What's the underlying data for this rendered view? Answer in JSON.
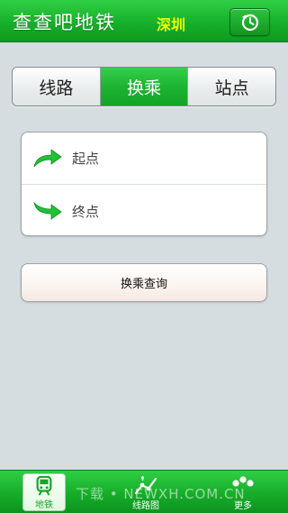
{
  "header": {
    "title": "查查吧地铁",
    "city": "深圳",
    "history_icon": "clock-refresh-icon"
  },
  "tabs": [
    {
      "label": "线路",
      "active": false
    },
    {
      "label": "换乘",
      "active": true
    },
    {
      "label": "站点",
      "active": false
    }
  ],
  "route": {
    "start_placeholder": "起点",
    "end_placeholder": "终点",
    "start_icon": "arrow-up-right-icon",
    "end_icon": "arrow-down-right-icon"
  },
  "search_button_label": "换乘查询",
  "tabbar": {
    "items": [
      {
        "label": "地铁",
        "icon": "train-icon",
        "active": true
      },
      {
        "label": "线路图",
        "icon": "route-map-icon",
        "active": false
      },
      {
        "label": "更多",
        "icon": "more-dots-icon",
        "active": false
      }
    ]
  },
  "watermark": "下载 • NEWXH.COM.CN",
  "colors": {
    "accent_green": "#1db431",
    "city_yellow": "#f3ff00",
    "background": "#d6dde0"
  }
}
